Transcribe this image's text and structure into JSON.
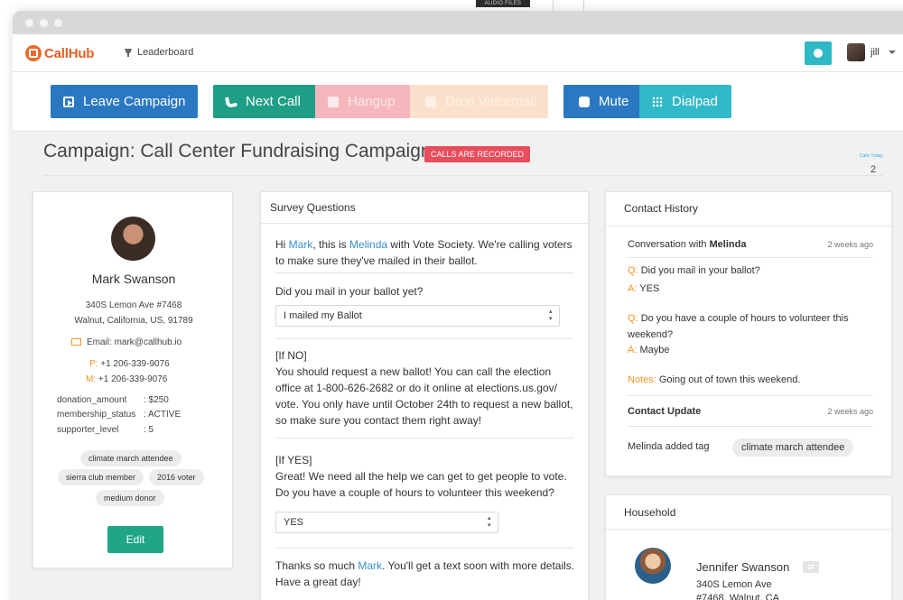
{
  "window": {
    "audio_tag": "AUDIO FILES"
  },
  "nav": {
    "brand": "CallHub",
    "leaderboard": "Leaderboard",
    "user": "jill"
  },
  "actions": {
    "leave": "Leave Campaign",
    "next": "Next Call",
    "hangup": "Hangup",
    "voicemail": "Drop Voicemail",
    "mute": "Mute",
    "dialpad": "Dialpad"
  },
  "campaign": {
    "title": "Campaign: Call Center Fundraising Campaign",
    "recorded_badge": "CALLS ARE RECORDED",
    "calls_today_label": "Calls Today",
    "calls_today": "2"
  },
  "contact": {
    "name": "Mark Swanson",
    "address1": "340S Lemon Ave #7468",
    "address2": "Walnut, California, US, 91789",
    "email_label": "Email:",
    "email": "mark@callhub.io",
    "phone_label": "P:",
    "phone": "+1 206-339-9076",
    "mobile_label": "M:",
    "mobile": "+1 206-339-9076",
    "attributes": [
      {
        "key": "donation_amount",
        "value": ": $250"
      },
      {
        "key": "membership_status",
        "value": ": ACTIVE"
      },
      {
        "key": "supporter_level",
        "value": ": 5"
      }
    ],
    "tags": [
      "climate march attendee",
      "sierra club member",
      "2016 voter",
      "medium donor"
    ],
    "edit": "Edit"
  },
  "survey": {
    "title": "Survey Questions",
    "intro_hi": "Hi ",
    "intro_name": "Mark",
    "intro_mid": ", this is ",
    "intro_agent": "Melinda",
    "intro_rest": " with Vote Society. We're calling voters to make sure they've mailed in their ballot.",
    "q1": "Did you mail in your ballot yet?",
    "q1_answer": "I mailed my Ballot",
    "if_no_label": "[If NO]",
    "if_no_text": "You should request a new ballot! You can call the election office at 1-800-626-2682 or do it online at elections.us.gov/ vote. You only have until October 24th to request a new ballot, so make sure  you contact them right away!",
    "if_yes_label": "[If YES]",
    "if_yes_text": "Great! We need all the help we can get to get people to vote. Do you have a couple of hours to volunteer this weekend?",
    "q2_answer": "YES",
    "closing_pre": "Thanks so much ",
    "closing_name": "Mark",
    "closing_rest": ". You'll get a text soon with more details. Have a great day!"
  },
  "history": {
    "title": "Contact History",
    "conv_label": "Conversation with ",
    "conv_agent": "Melinda",
    "conv_time": "2 weeks ago",
    "q_prefix": "Q:",
    "a_prefix": "A:",
    "q1": "Did you mail in your ballot?",
    "a1": "YES",
    "q2": "Do you have a couple of hours to volunteer this weekend?",
    "a2": "Maybe",
    "notes_label": "Notes:",
    "notes": "Going out of town this weekend.",
    "update_label": "Contact Update",
    "update_time": "2 weeks ago",
    "update_text": "Melinda added tag",
    "update_tag": "climate march attendee"
  },
  "household": {
    "title": "Household",
    "name": "Jennifer Swanson",
    "address1": "340S Lemon Ave",
    "address2": "#7468, Walnut, CA"
  },
  "colors": {
    "brand": "#e45f23",
    "primary": "#2a78c2",
    "success": "#1f9e86",
    "danger": "#e94c5b",
    "accent": "#31b9c9",
    "highlight": "#f29725",
    "link": "#3a8fd0"
  }
}
